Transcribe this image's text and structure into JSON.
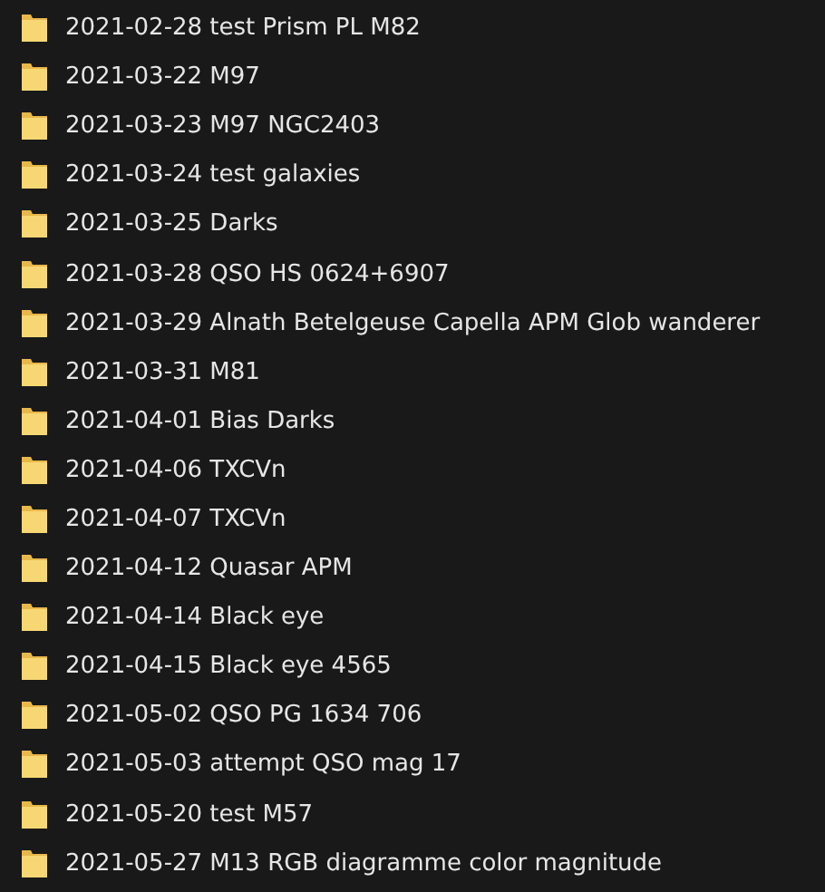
{
  "folders": [
    {
      "name": "2021-02-28 test Prism PL M82"
    },
    {
      "name": "2021-03-22 M97"
    },
    {
      "name": "2021-03-23 M97 NGC2403"
    },
    {
      "name": "2021-03-24 test galaxies"
    },
    {
      "name": "2021-03-25 Darks"
    },
    {
      "name": "2021-03-28 QSO HS 0624+6907"
    },
    {
      "name": "2021-03-29 Alnath Betelgeuse Capella APM Glob wanderer"
    },
    {
      "name": "2021-03-31 M81"
    },
    {
      "name": "2021-04-01 Bias Darks"
    },
    {
      "name": "2021-04-06 TXCVn"
    },
    {
      "name": "2021-04-07 TXCVn"
    },
    {
      "name": "2021-04-12 Quasar APM"
    },
    {
      "name": "2021-04-14 Black eye"
    },
    {
      "name": "2021-04-15 Black eye 4565"
    },
    {
      "name": "2021-05-02 QSO PG 1634 706"
    },
    {
      "name": "2021-05-03 attempt QSO mag 17"
    },
    {
      "name": "2021-05-20 test M57"
    },
    {
      "name": "2021-05-27 M13 RGB diagramme color magnitude"
    }
  ]
}
